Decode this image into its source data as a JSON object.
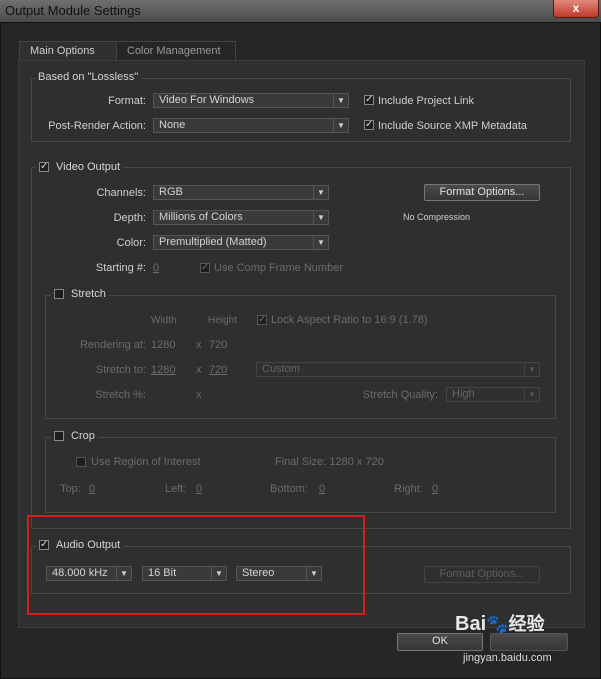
{
  "window": {
    "title": "Output Module Settings",
    "close_symbol": "x"
  },
  "tabs": [
    {
      "label": "Main Options",
      "active": true
    },
    {
      "label": "Color Management",
      "active": false
    }
  ],
  "based_on": {
    "title": "Based on \"Lossless\"",
    "format_label": "Format:",
    "format_value": "Video For Windows",
    "post_render_label": "Post-Render Action:",
    "post_render_value": "None",
    "include_project_link": "Include Project Link",
    "include_xmp": "Include Source XMP Metadata"
  },
  "video_output": {
    "title": "Video Output",
    "channels_label": "Channels:",
    "channels_value": "RGB",
    "depth_label": "Depth:",
    "depth_value": "Millions of Colors",
    "color_label": "Color:",
    "color_value": "Premultiplied (Matted)",
    "starting_label": "Starting #:",
    "starting_value": "0",
    "use_comp_frame": "Use Comp Frame Number",
    "format_options": "Format Options...",
    "compression": "No Compression"
  },
  "stretch": {
    "title": "Stretch",
    "width_header": "Width",
    "height_header": "Height",
    "lock_aspect": "Lock Aspect Ratio to 16:9 (1.78)",
    "rendering_at_label": "Rendering at:",
    "rendering_w": "1280",
    "rendering_h": "720",
    "stretch_to_label": "Stretch to:",
    "stretch_w": "1280",
    "stretch_h": "720",
    "stretch_preset": "Custom",
    "stretch_pct_label": "Stretch %:",
    "x": "x",
    "quality_label": "Stretch Quality:",
    "quality_value": "High"
  },
  "crop": {
    "title": "Crop",
    "use_roi": "Use Region of Interest",
    "final_size": "Final Size: 1280 x 720",
    "top_label": "Top:",
    "top_value": "0",
    "left_label": "Left:",
    "left_value": "0",
    "bottom_label": "Bottom:",
    "bottom_value": "0",
    "right_label": "Right:",
    "right_value": "0"
  },
  "audio_output": {
    "title": "Audio Output",
    "rate": "48.000 kHz",
    "bits": "16 Bit",
    "channels": "Stereo",
    "format_options": "Format Options..."
  },
  "buttons": {
    "ok": "OK"
  },
  "watermark": {
    "logo": "Bai",
    "paw": "🐾",
    "suffix": "经验",
    "url": "jingyan.baidu.com"
  },
  "colors": {
    "highlight": "#d12020",
    "background": "#2b2b2b"
  }
}
